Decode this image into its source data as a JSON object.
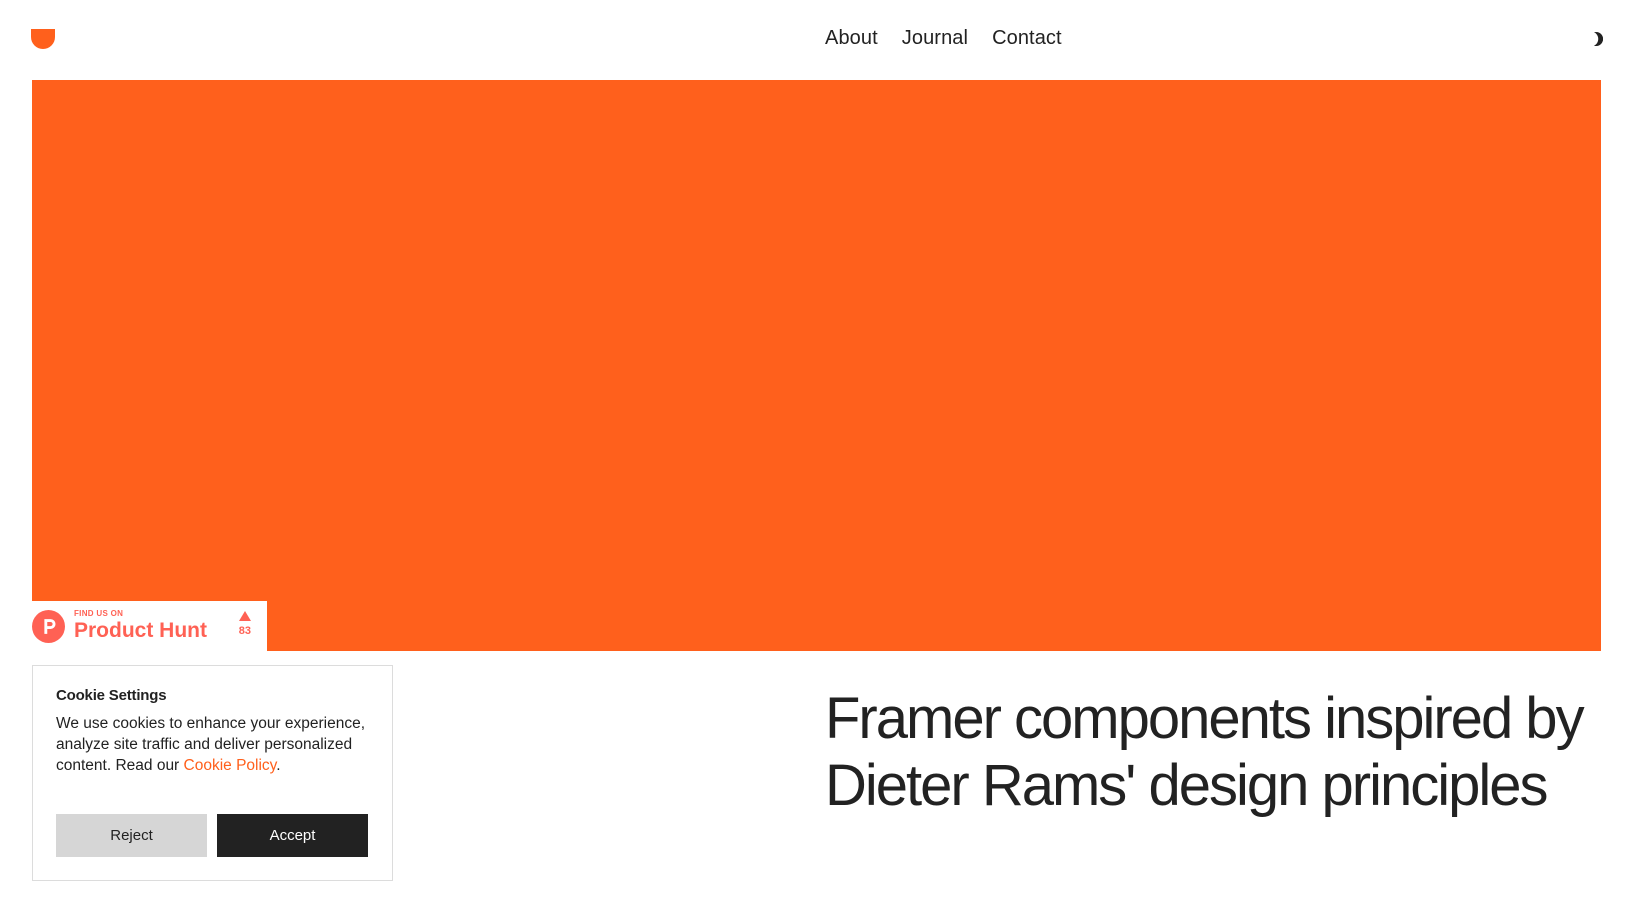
{
  "colors": {
    "accent": "#ff601c",
    "text": "#222222",
    "background": "#ffffff",
    "product_hunt": "#ff6154"
  },
  "header": {
    "logo_icon": "orange-shield-logo",
    "nav": [
      {
        "label": "About"
      },
      {
        "label": "Journal"
      },
      {
        "label": "Contact"
      }
    ],
    "theme_toggle_icon": "half-moon-icon"
  },
  "product_hunt": {
    "find_label": "FIND US ON",
    "name": "Product Hunt",
    "votes": "83",
    "logo_letter": "P"
  },
  "cookie": {
    "title": "Cookie Settings",
    "body": "We use cookies to enhance your experience, analyze site traffic and deliver personalized content. Read our ",
    "link_label": "Cookie Policy",
    "body_end": ".",
    "reject_label": "Reject",
    "accept_label": "Accept"
  },
  "main": {
    "headline": "Framer components inspired by Dieter Rams' design principles"
  }
}
